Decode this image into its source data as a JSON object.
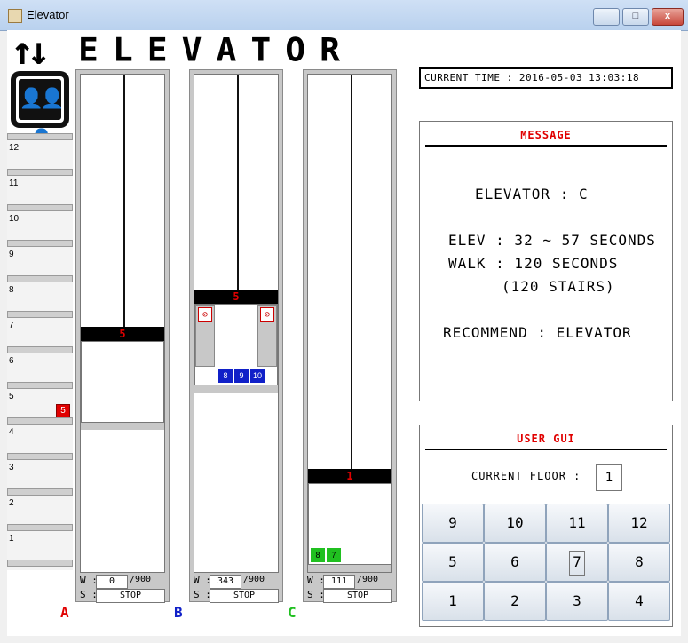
{
  "window": {
    "title": "Elevator",
    "controls": {
      "minimize": "_",
      "maximize": "□",
      "close": "x"
    }
  },
  "header": {
    "arrows": "↑↓",
    "title": "ELEVATOR"
  },
  "floors": [
    "12",
    "11",
    "10",
    "9",
    "8",
    "7",
    "6",
    "5",
    "4",
    "3",
    "2",
    "1"
  ],
  "floor_call": {
    "floor": "5"
  },
  "elevators": [
    {
      "letter": "A",
      "color": "#e00000",
      "display": "5",
      "w_value": "0",
      "w_max": "/900",
      "status": "STOP",
      "panel_buttons": []
    },
    {
      "letter": "B",
      "color": "#1020c8",
      "display": "5",
      "w_value": "343",
      "w_max": "/900",
      "status": "STOP",
      "panel_buttons": [
        "8",
        "9",
        "10"
      ]
    },
    {
      "letter": "C",
      "color": "#20c020",
      "display": "1",
      "w_value": "111",
      "w_max": "/900",
      "status": "STOP",
      "panel_buttons": [
        "8",
        "7"
      ]
    }
  ],
  "labels": {
    "w": "W :",
    "s": "S :"
  },
  "current_time": "CURRENT TIME : 2016-05-03 13:03:18",
  "message": {
    "title": "MESSAGE",
    "elevator": "ELEVATOR : C",
    "elev_time": "ELEV : 32 ~ 57 SECONDS",
    "walk_time": "WALK : 120 SECONDS",
    "stairs": "(120 STAIRS)",
    "recommend": "RECOMMEND : ELEVATOR"
  },
  "user_gui": {
    "title": "USER GUI",
    "current_floor_label": "CURRENT FLOOR :",
    "current_floor": "1",
    "keypad": [
      [
        "9",
        "10",
        "11",
        "12"
      ],
      [
        "5",
        "6",
        "7",
        "8"
      ],
      [
        "1",
        "2",
        "3",
        "4"
      ]
    ],
    "selected_key": "7"
  }
}
